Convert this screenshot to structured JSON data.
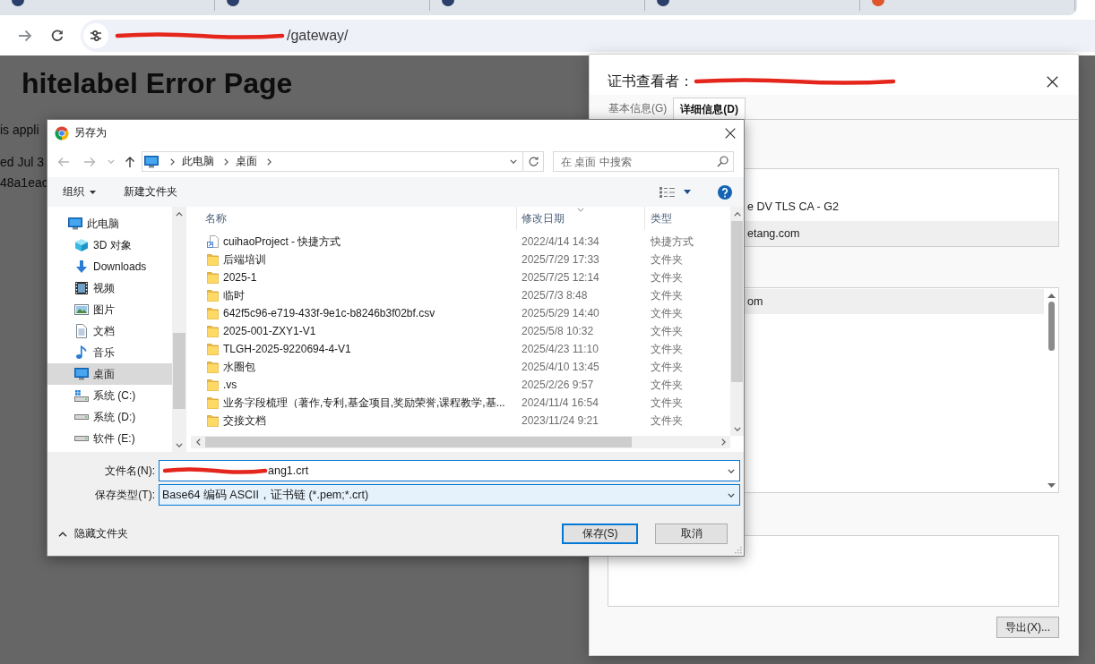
{
  "browser": {
    "tabs": [
      {
        "color": "#2a3f6b"
      },
      {
        "color": "#2a3f6b"
      },
      {
        "color": "#2a3f6b"
      },
      {
        "color": "#2a3f6b"
      },
      {
        "color": "#e0542e"
      }
    ],
    "url": "/gateway/",
    "url_redacted": true
  },
  "page": {
    "heading": "hitelabel Error Page",
    "lines": [
      "is appli",
      "ed Jul 3",
      "48a1eac"
    ]
  },
  "cert_viewer": {
    "title": "证书查看者：",
    "title_redacted": true,
    "tabs": [
      {
        "label": "基本信息(G)",
        "selected": false
      },
      {
        "label": "详细信息(D)",
        "selected": true
      }
    ],
    "hierarchy": [
      {
        "text": "e DV TLS CA - G2",
        "selected": false
      },
      {
        "text": "etang.com",
        "selected": true
      }
    ],
    "fields": [
      {
        "text": "om",
        "selected": true
      }
    ],
    "export_button": "导出(X)..."
  },
  "save_dialog": {
    "title": "另存为",
    "nav_buttons": [
      {
        "kind": "back",
        "disabled": true
      },
      {
        "kind": "forward",
        "disabled": true
      },
      {
        "kind": "recent",
        "disabled": true
      },
      {
        "kind": "up",
        "disabled": false
      }
    ],
    "path": [
      "此电脑",
      "桌面"
    ],
    "search": {
      "placeholder": "在 桌面 中搜索"
    },
    "toolbar": [
      {
        "label": "组织",
        "kind": "menu"
      },
      {
        "label": "新建文件夹",
        "kind": "command"
      }
    ],
    "nav_tree": [
      {
        "label": "此电脑",
        "kind": "pc",
        "selected": false,
        "children": [
          {
            "label": "3D 对象",
            "kind": "objects3d",
            "selected": false
          },
          {
            "label": "Downloads",
            "kind": "downloads",
            "selected": false
          },
          {
            "label": "视频",
            "kind": "videos",
            "selected": false
          },
          {
            "label": "图片",
            "kind": "pictures",
            "selected": false
          },
          {
            "label": "文档",
            "kind": "documents",
            "selected": false
          },
          {
            "label": "音乐",
            "kind": "music",
            "selected": false
          },
          {
            "label": "桌面",
            "kind": "desktop",
            "selected": true
          },
          {
            "label": "系统 (C:)",
            "kind": "system_drive",
            "selected": false
          },
          {
            "label": "系统 (D:)",
            "kind": "drive",
            "selected": false
          },
          {
            "label": "软件 (E:)",
            "kind": "drive",
            "selected": false
          }
        ]
      }
    ],
    "columns": [
      {
        "label": "名称",
        "sorted": false
      },
      {
        "label": "修改日期",
        "sorted": true
      },
      {
        "label": "类型",
        "sorted": false
      }
    ],
    "files": [
      {
        "name": "cuihaoProject - 快捷方式",
        "date": "2022/4/14 14:34",
        "type": "快捷方式",
        "kind": "shortcut"
      },
      {
        "name": "后端培训",
        "date": "2025/7/29 17:33",
        "type": "文件夹",
        "kind": "folder"
      },
      {
        "name": "2025-1",
        "date": "2025/7/25 12:14",
        "type": "文件夹",
        "kind": "folder"
      },
      {
        "name": "临时",
        "date": "2025/7/3 8:48",
        "type": "文件夹",
        "kind": "folder"
      },
      {
        "name": "642f5c96-e719-433f-9e1c-b8246b3f02bf.csv",
        "date": "2025/5/29 14:40",
        "type": "文件夹",
        "kind": "folder"
      },
      {
        "name": "2025-001-ZXY1-V1",
        "date": "2025/5/8 10:32",
        "type": "文件夹",
        "kind": "folder"
      },
      {
        "name": "TLGH-2025-9220694-4-V1",
        "date": "2025/4/23 11:10",
        "type": "文件夹",
        "kind": "folder"
      },
      {
        "name": "水圈包",
        "date": "2025/4/10 13:45",
        "type": "文件夹",
        "kind": "folder"
      },
      {
        "name": ".vs",
        "date": "2025/2/26 9:57",
        "type": "文件夹",
        "kind": "folder"
      },
      {
        "name": "业务字段梳理（著作,专利,基金项目,奖励荣誉,课程教学,基...",
        "date": "2024/11/4 16:54",
        "type": "文件夹",
        "kind": "folder"
      },
      {
        "name": "交接文档",
        "date": "2023/11/24 9:21",
        "type": "文件夹",
        "kind": "folder"
      }
    ],
    "filename": {
      "label": "文件名(N):",
      "value": "ang1.crt",
      "redacted": true
    },
    "file_type": {
      "label": "保存类型(T):",
      "value": "Base64 编码 ASCII，证书链 (*.pem;*.crt)"
    },
    "hide_folders": "隐藏文件夹",
    "buttons": [
      {
        "label": "保存(S)",
        "default": true
      },
      {
        "label": "取消",
        "default": false
      }
    ]
  }
}
